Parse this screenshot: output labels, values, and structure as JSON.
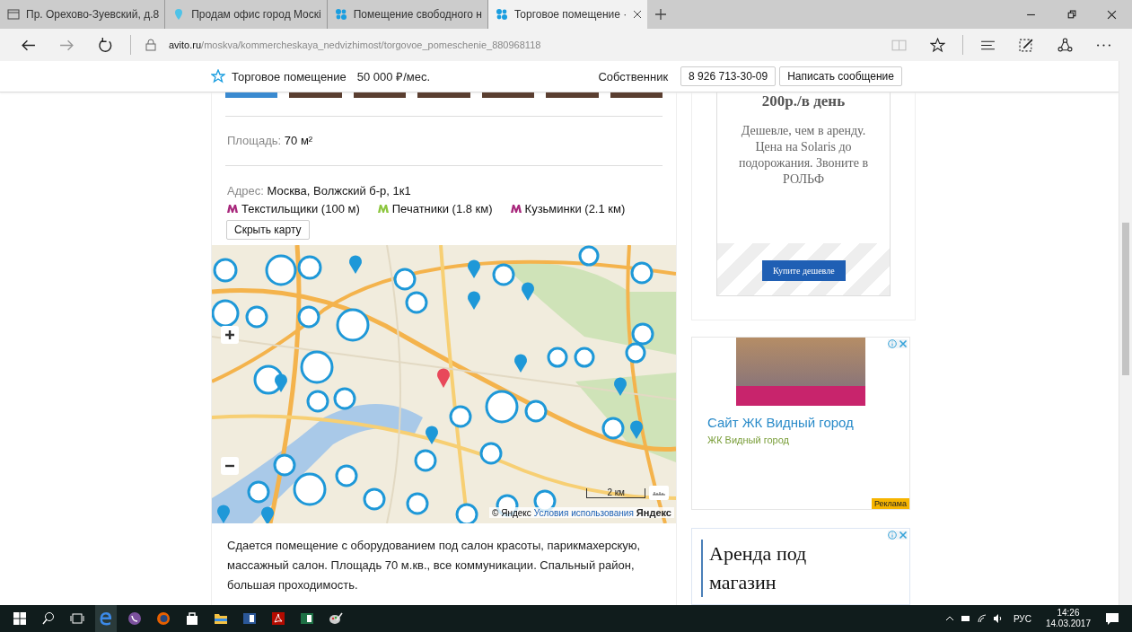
{
  "tabs": [
    {
      "title": "Пр. Орехово-Зуевский, д.8",
      "kind": "page",
      "selected": false
    },
    {
      "title": "Продам офис город Москі",
      "kind": "pin",
      "selected": false
    },
    {
      "title": "Помещение свободного н",
      "kind": "avito",
      "selected": false
    },
    {
      "title": "Торговое помещение ·",
      "kind": "avito",
      "selected": true
    }
  ],
  "address": {
    "domain": "avito.ru",
    "path": "/moskva/kommercheskaya_nedvizhimost/torgovoe_pomeschenie_880968118"
  },
  "header": {
    "title": "Торговое помещение",
    "price": "50 000 ₽/мес.",
    "seller": "Собственник",
    "phone": "8 926 713-30-09",
    "message_button": "Написать сообщение"
  },
  "listing": {
    "area_label": "Площадь:",
    "area_value": "70 м²",
    "address_label": "Адрес:",
    "address_value": "Москва, Волжский б-р, 1к1",
    "metro": [
      {
        "name": "Текстильщики (100 м)",
        "color": "#a8287c"
      },
      {
        "name": "Печатники (1.8 км)",
        "color": "#8dc63f"
      },
      {
        "name": "Кузьминки (2.1 км)",
        "color": "#a8287c"
      }
    ],
    "hide_map_button": "Скрыть карту",
    "map": {
      "scale": "2 км",
      "copyright": "© Яндекс",
      "terms": "Условия использования",
      "logo": "Яндекс"
    },
    "description": "Сдается помещение с оборудованием под салон красоты, парикмахерскую, массажный салон. Площадь 70 м.кв., все коммуникации. Спальный район, большая проходимость."
  },
  "ads": {
    "first": {
      "headline": "200р./в день",
      "text": "Дешевле, чем в аренду. Цена на Solaris до подорожания. Звоните в РОЛЬФ",
      "button": "Купите дешевле"
    },
    "second": {
      "title": "Сайт ЖК Видный город",
      "subtitle": "ЖК Видный город",
      "label": "Реклама"
    },
    "third": {
      "title": "Аренда под магазин"
    }
  },
  "taskbar": {
    "language": "РУС",
    "time": "14:26",
    "date": "14.03.2017"
  }
}
